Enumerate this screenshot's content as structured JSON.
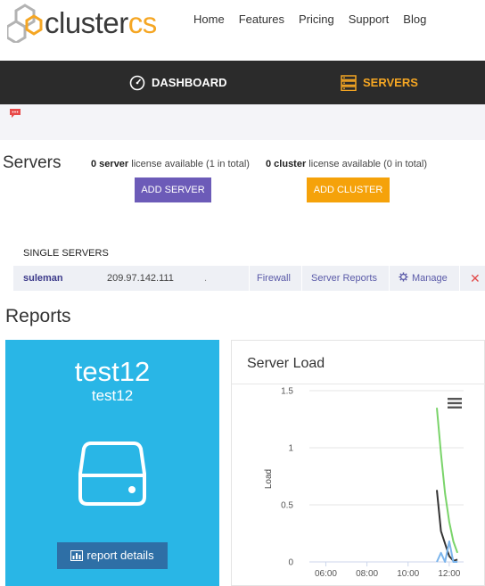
{
  "brand": {
    "name_part1": "cluster",
    "name_part2": "cs",
    "accent_color": "#f5a623"
  },
  "topnav": [
    "Home",
    "Features",
    "Pricing",
    "Support",
    "Blog"
  ],
  "tabs": [
    {
      "label": "DASHBOARD",
      "icon": "speedometer-icon"
    },
    {
      "label": "SERVERS",
      "icon": "server-stack-icon",
      "active": true
    }
  ],
  "servers": {
    "title": "Servers",
    "server_license": {
      "count": "0 server",
      "text": " license available (1 in total)"
    },
    "cluster_license": {
      "count": "0 cluster",
      "text": " license available (0 in total)"
    },
    "add_server_label": "ADD SERVER",
    "add_cluster_label": "ADD CLUSTER",
    "single_title": "SINGLE SERVERS",
    "rows": [
      {
        "name": "suleman",
        "ip": "209.97.142.111",
        "dot": ".",
        "firewall": "Firewall",
        "reports": "Server Reports",
        "manage": "Manage",
        "remove": "✕"
      }
    ]
  },
  "reports": {
    "title": "Reports",
    "card": {
      "name": "test12",
      "sub": "test12",
      "button": "report details"
    },
    "load": {
      "title": "Server Load"
    }
  },
  "chart_data": {
    "type": "line",
    "title": "Server Load",
    "ylabel": "Load",
    "xlabel": "",
    "yticks": [
      "1.5",
      "1",
      "0.5",
      "0"
    ],
    "xticks": [
      "06:00",
      "08:00",
      "10:00",
      "12:00"
    ],
    "ylim": [
      0,
      1.5
    ],
    "xlim": [
      5.2,
      12.7
    ],
    "x_tick_values": [
      6,
      8,
      10,
      12
    ],
    "grid": true,
    "series": [
      {
        "color": "#7ad46a",
        "x": [
          11.4,
          11.6,
          11.8,
          12.0,
          12.2,
          12.4
        ],
        "y": [
          1.35,
          0.95,
          0.6,
          0.35,
          0.18,
          0.08
        ]
      },
      {
        "color": "#333333",
        "x": [
          11.4,
          11.6,
          11.8,
          12.0,
          12.2,
          12.4
        ],
        "y": [
          0.63,
          0.27,
          0.16,
          0.05,
          0.01,
          0.02
        ]
      },
      {
        "color": "#7cb5ec",
        "x": [
          11.4,
          11.6,
          11.8,
          12.0,
          12.2,
          12.4
        ],
        "y": [
          0.0,
          0.08,
          0.0,
          0.18,
          0.0,
          0.0
        ]
      }
    ]
  }
}
